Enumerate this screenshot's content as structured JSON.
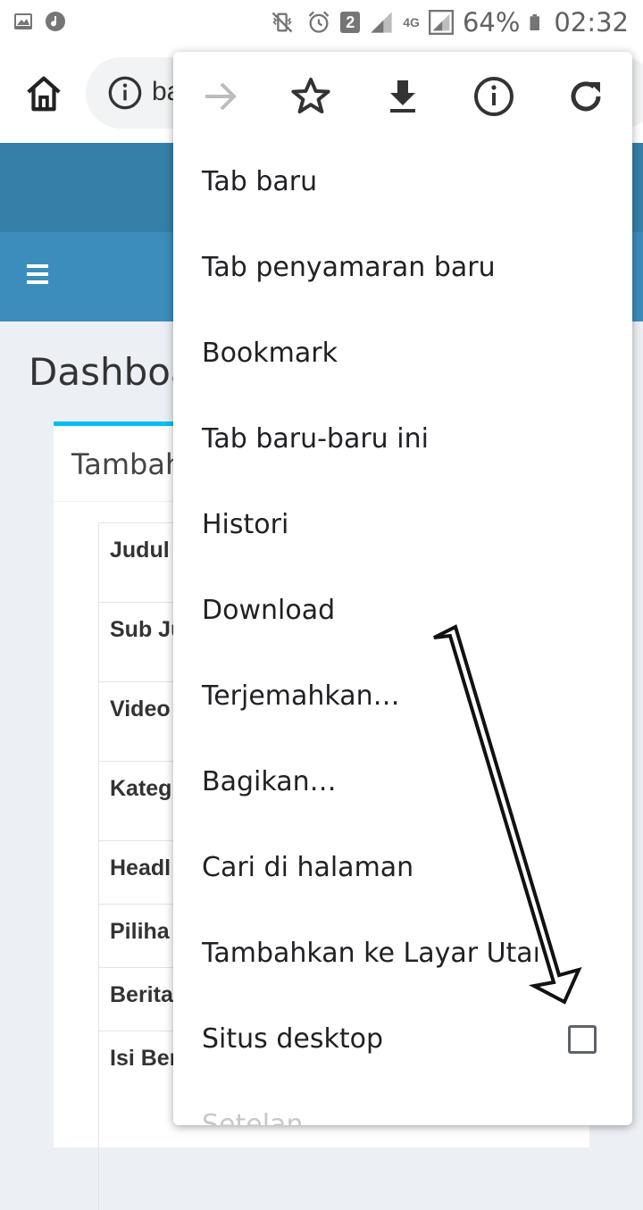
{
  "status_bar": {
    "battery": "64%",
    "time": "02:32",
    "sim_badge": "2",
    "network": "4G"
  },
  "browser": {
    "url_text": "ba"
  },
  "page": {
    "dashboard_title": "Dashboa",
    "box_title": "Tambah",
    "form_labels": [
      "Judul",
      "Sub Ju",
      "Video",
      "Kateg",
      "Headl",
      "Piliha",
      "Berita",
      "Isi Ber"
    ]
  },
  "menu": {
    "items": [
      "Tab baru",
      "Tab penyamaran baru",
      "Bookmark",
      "Tab baru-baru ini",
      "Histori",
      "Download",
      "Terjemahkan…",
      "Bagikan…",
      "Cari di halaman",
      "Tambahkan ke Layar Utama",
      "Situs desktop",
      "Setelan"
    ],
    "desktop_site_checked": false
  },
  "colors": {
    "header_dark": "#367fa9",
    "header_light": "#3c8dbc",
    "box_accent": "#00c0ef"
  }
}
